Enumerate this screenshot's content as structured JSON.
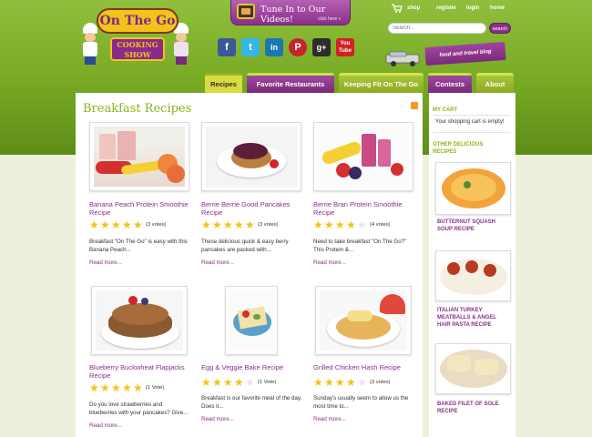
{
  "header": {
    "logo_title": "On The Go",
    "logo_sub": "COOKING SHOW",
    "tunein_text": "Tune In to Our Videos!",
    "tunein_click": "click here »",
    "toplinks": [
      "shop",
      "register",
      "login",
      "home"
    ],
    "search_placeholder": "Search...",
    "search_button": "search",
    "food_travel": "food and travel blog",
    "social": [
      {
        "name": "facebook-icon",
        "glyph": "f",
        "color": "#3b5998"
      },
      {
        "name": "twitter-icon",
        "glyph": "t",
        "color": "#35b6e6"
      },
      {
        "name": "linkedin-icon",
        "glyph": "in",
        "color": "#1b77b4"
      },
      {
        "name": "pinterest-icon",
        "glyph": "P",
        "color": "#c8232c"
      },
      {
        "name": "googleplus-icon",
        "glyph": "g+",
        "color": "#2d2d2d"
      },
      {
        "name": "youtube-icon",
        "glyph": "You Tube",
        "color": "#d42121"
      }
    ]
  },
  "nav": {
    "tabs": [
      "Recipes",
      "Favorite Restaurants",
      "Keeping Fit On The Go",
      "Contests",
      "About"
    ],
    "active": "Recipes"
  },
  "main": {
    "title": "Breakfast Recipes",
    "read_more": "Read more...",
    "recipes": [
      {
        "title": "Banana Peach Protein Smoothie Recipe",
        "rating": 5,
        "votes": "(3 votes)",
        "desc": "Breakfast \"On The Go\" is easy with this Banana Peach..."
      },
      {
        "title": "Berrie Berrie Good Pancakes Recipe",
        "rating": 5,
        "votes": "(3 votes)",
        "desc": "These delicious quick & easy berry pancakes are packed with..."
      },
      {
        "title": "Berrie Bran Protein Smoothie Recipe",
        "rating": 4,
        "votes": "(4 votes)",
        "desc": "Need to take breakfast \"On The Go?\" This Protein &..."
      },
      {
        "title": "Blueberry Buckwheat Flapjacks Recipe",
        "rating": 5,
        "votes": "(1 Vote)",
        "desc": "Do you love strawberries and blueberries with your pancakes? Give..."
      },
      {
        "title": "Egg & Veggie Bake Recipe",
        "rating": 4,
        "votes": "(1 Vote)",
        "desc": "Breakfast is our favorite meal of the day. Does it..."
      },
      {
        "title": "Grilled Chicken Hash Recipe",
        "rating": 4,
        "votes": "(3 votes)",
        "desc": "Sunday's usually seem to allow us the most time to..."
      }
    ]
  },
  "sidebar": {
    "cart_head": "MY CART",
    "cart_text": "Your shopping cart is empty!",
    "other_head": "OTHER DELICIOUS RECIPES",
    "others": [
      "BUTTERNUT SQUASH SOUP RECIPE",
      "ITALIAN TURKEY MEATBALLS & ANGEL HAIR PASTA RECIPE",
      "BAKED FILET OF SOLE RECIPE"
    ]
  }
}
